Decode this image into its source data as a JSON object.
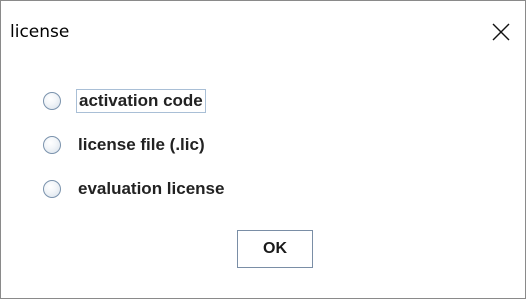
{
  "window": {
    "title": "license",
    "close_icon": "close-icon"
  },
  "options": [
    {
      "label": "activation code",
      "selected": false,
      "focused": true
    },
    {
      "label": "license file (.lic)",
      "selected": false,
      "focused": false
    },
    {
      "label": "evaluation license",
      "selected": false,
      "focused": false
    }
  ],
  "buttons": {
    "ok_label": "OK"
  },
  "colors": {
    "background": "#ffffff",
    "border": "#8a8a8a",
    "radio_border": "#7b93ad",
    "focus_border": "#a9bfd6",
    "button_border": "#7a8ea6"
  }
}
